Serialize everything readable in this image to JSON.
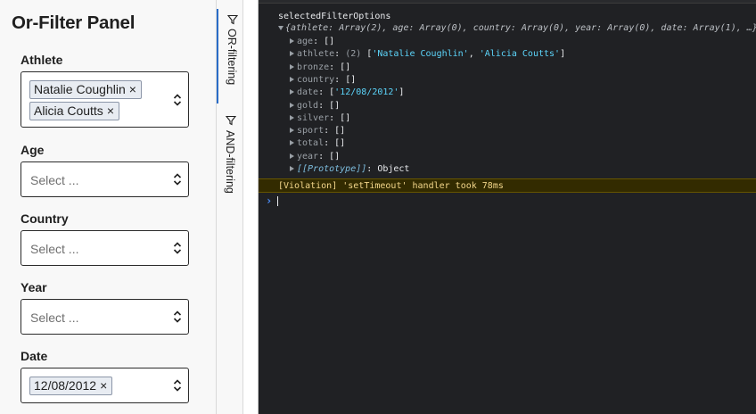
{
  "panel": {
    "title": "Or-Filter Panel",
    "placeholder": "Select ...",
    "fields": {
      "athlete": {
        "label": "Athlete",
        "chips": [
          "Natalie Coughlin",
          "Alicia Coutts"
        ]
      },
      "age": {
        "label": "Age"
      },
      "country": {
        "label": "Country"
      },
      "year": {
        "label": "Year"
      },
      "date": {
        "label": "Date",
        "chips": [
          "12/08/2012"
        ]
      }
    },
    "chip_remove_glyph": "×"
  },
  "tabs": [
    {
      "label": "OR-filtering",
      "icon": "filter-icon",
      "active": true
    },
    {
      "label": "AND-filtering",
      "icon": "filter-icon",
      "active": false
    }
  ],
  "console": {
    "title_line": "selectedFilterOptions",
    "summary": "{athlete: Array(2), age: Array(0), country: Array(0), year: Array(0), date: Array(1), …}",
    "props": [
      {
        "key": "age",
        "value": "[]"
      },
      {
        "key": "athlete",
        "count": "(2)",
        "value_open": "[",
        "items": [
          "'Natalie Coughlin'",
          "'Alicia Coutts'"
        ],
        "value_close": "]"
      },
      {
        "key": "bronze",
        "value": "[]"
      },
      {
        "key": "country",
        "value": "[]"
      },
      {
        "key": "date",
        "value_open": "[",
        "items": [
          "'12/08/2012'"
        ],
        "value_close": "]"
      },
      {
        "key": "gold",
        "value": "[]"
      },
      {
        "key": "silver",
        "value": "[]"
      },
      {
        "key": "sport",
        "value": "[]"
      },
      {
        "key": "total",
        "value": "[]"
      },
      {
        "key": "year",
        "value": "[]"
      }
    ],
    "prototype_key": "[[Prototype]]",
    "prototype_value": "Object",
    "warning": "[Violation] 'setTimeout' handler took 78ms",
    "prompt": "›"
  },
  "colors": {
    "panel_bg": "#f8f8f8",
    "console_bg": "#202124",
    "string": "#5cd5fb",
    "warning_text": "#f3d68a",
    "warning_bg": "#332b00",
    "active_tab": "#2a6cc8",
    "chip_bg": "#e8ecf2"
  }
}
